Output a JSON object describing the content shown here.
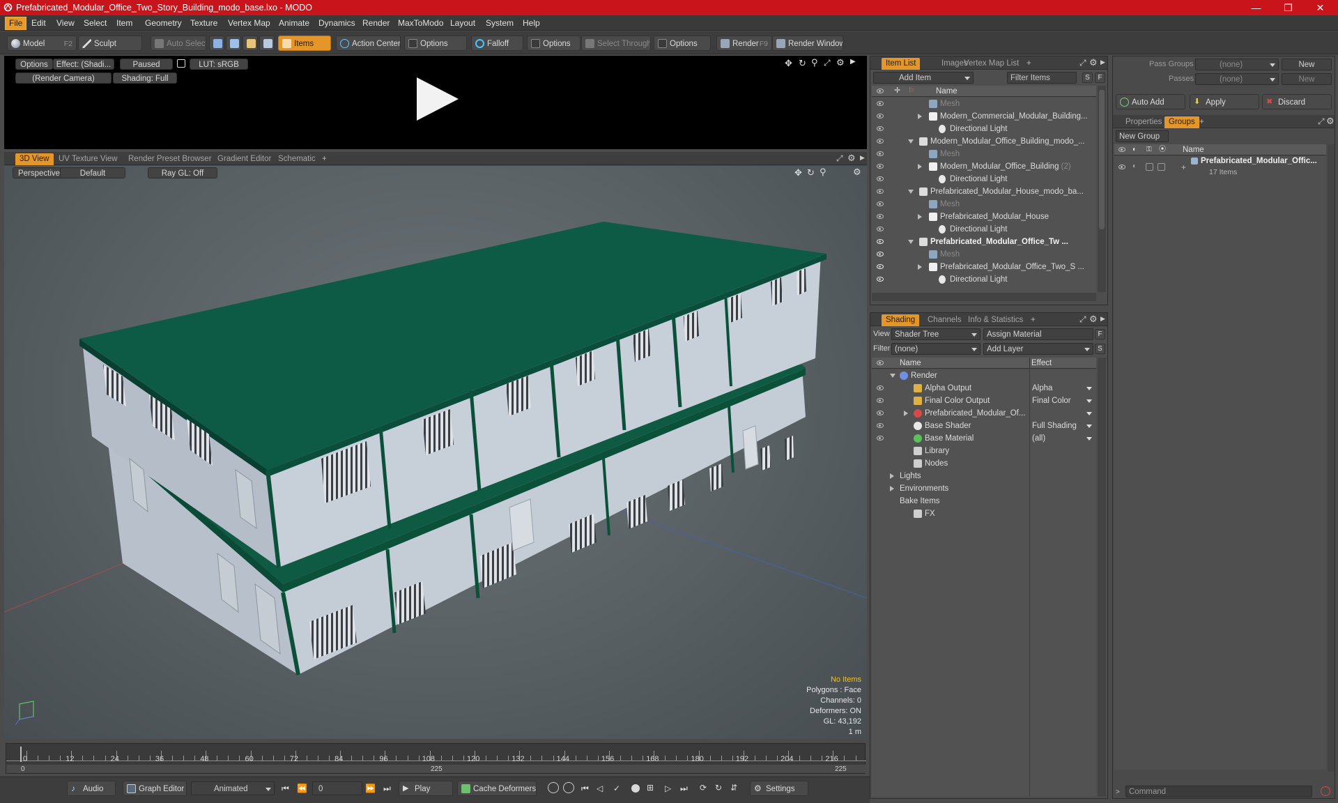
{
  "window": {
    "title": "Prefabricated_Modular_Office_Two_Story_Building_modo_base.lxo - MODO"
  },
  "menu": [
    "File",
    "Edit",
    "View",
    "Select",
    "Item",
    "Geometry",
    "Texture",
    "Vertex Map",
    "Animate",
    "Dynamics",
    "Render",
    "MaxToModo",
    "Layout",
    "System",
    "Help"
  ],
  "toolbar": {
    "model": "Model",
    "model_key": "F2",
    "sculpt": "Sculpt",
    "auto_select": "Auto Select",
    "items": "Items",
    "action_center": "Action Center",
    "options1": "Options",
    "falloff": "Falloff",
    "options2": "Options",
    "select_through": "Select Through",
    "options3": "Options",
    "render": "Render",
    "render_key": "F9",
    "render_window": "Render Window"
  },
  "preview": {
    "options": "Options",
    "effect": "Effect: (Shadi...",
    "paused": "Paused",
    "lut": "LUT: sRGB",
    "camera": "(Render Camera)",
    "shading": "Shading: Full"
  },
  "viewport_tabs": [
    "3D View",
    "UV Texture View",
    "Render Preset Browser",
    "Gradient Editor",
    "Schematic"
  ],
  "viewport": {
    "perspective": "Perspective",
    "default": "Default",
    "raygl": "Ray GL: Off",
    "status": {
      "no_items": "No Items",
      "polygons": "Polygons : Face",
      "channels": "Channels: 0",
      "deformers": "Deformers: ON",
      "gl": "GL: 43,192",
      "unit": "1 m"
    }
  },
  "item_list": {
    "tabs": [
      "Item List",
      "Images",
      "Vertex Map List"
    ],
    "add_item": "Add Item",
    "filter_items": "Filter Items",
    "s": "S",
    "f": "F",
    "col_name": "Name",
    "rows": [
      {
        "label": "Mesh",
        "dim": true
      },
      {
        "label": "Modern_Commercial_Modular_Building...",
        "dim": false
      },
      {
        "label": "Directional Light",
        "dim": false
      },
      {
        "label": "Modern_Modular_Office_Building_modo_...",
        "dim": false
      },
      {
        "label": "Mesh",
        "dim": true
      },
      {
        "label": "Modern_Modular_Office_Building",
        "dim": false,
        "suffix": "(2)"
      },
      {
        "label": "Directional Light",
        "dim": false
      },
      {
        "label": "Prefabricated_Modular_House_modo_ba...",
        "dim": false
      },
      {
        "label": "Mesh",
        "dim": true
      },
      {
        "label": "Prefabricated_Modular_House",
        "dim": false
      },
      {
        "label": "Directional Light",
        "dim": false
      },
      {
        "label": "Prefabricated_Modular_Office_Tw ...",
        "dim": false,
        "bold": true
      },
      {
        "label": "Mesh",
        "dim": true
      },
      {
        "label": "Prefabricated_Modular_Office_Two_S ...",
        "dim": false
      },
      {
        "label": "Directional Light",
        "dim": false
      }
    ]
  },
  "shading": {
    "tabs": [
      "Shading",
      "Channels",
      "Info & Statistics"
    ],
    "view_label": "View",
    "view_value": "Shader Tree",
    "assign_material": "Assign Material",
    "filter_label": "Filter",
    "filter_value": "(none)",
    "add_layer": "Add Layer",
    "col_name": "Name",
    "col_effect": "Effect",
    "rows": [
      {
        "label": "Render",
        "effect": ""
      },
      {
        "label": "Alpha Output",
        "effect": "Alpha"
      },
      {
        "label": "Final Color Output",
        "effect": "Final Color"
      },
      {
        "label": "Prefabricated_Modular_Of...",
        "effect": ""
      },
      {
        "label": "Base Shader",
        "effect": "Full Shading"
      },
      {
        "label": "Base Material",
        "effect": "(all)"
      },
      {
        "label": "Library",
        "effect": ""
      },
      {
        "label": "Nodes",
        "effect": ""
      },
      {
        "label": "Lights",
        "effect": ""
      },
      {
        "label": "Environments",
        "effect": ""
      },
      {
        "label": "Bake Items",
        "effect": ""
      },
      {
        "label": "FX",
        "effect": ""
      }
    ]
  },
  "groups": {
    "pass_groups": "Pass Groups",
    "pass_value": "(none)",
    "new": "New",
    "passes": "Passes",
    "passes_value": "(none)",
    "new2": "New",
    "auto_add": "Auto Add",
    "apply": "Apply",
    "discard": "Discard",
    "tabs": [
      "Properties",
      "Groups"
    ],
    "new_group": "New Group",
    "col_name": "Name",
    "item_name": "Prefabricated_Modular_Offic...",
    "item_count": "17 Items"
  },
  "timeline": {
    "ticks": [
      "0",
      "12",
      "24",
      "36",
      "48",
      "60",
      "72",
      "84",
      "96",
      "108",
      "120",
      "132",
      "144",
      "156",
      "168",
      "180",
      "192",
      "204",
      "216"
    ],
    "range_start": "0",
    "range_mid": "225",
    "range_end": "225"
  },
  "bottom": {
    "audio": "Audio",
    "graph_editor": "Graph Editor",
    "animated": "Animated",
    "frame": "0",
    "play": "Play",
    "cache_deformers": "Cache Deformers",
    "settings": "Settings",
    "command": "Command"
  },
  "colors": {
    "accent": "#e49628",
    "titlebar": "#c8141a",
    "roof": "#0d5a45"
  }
}
